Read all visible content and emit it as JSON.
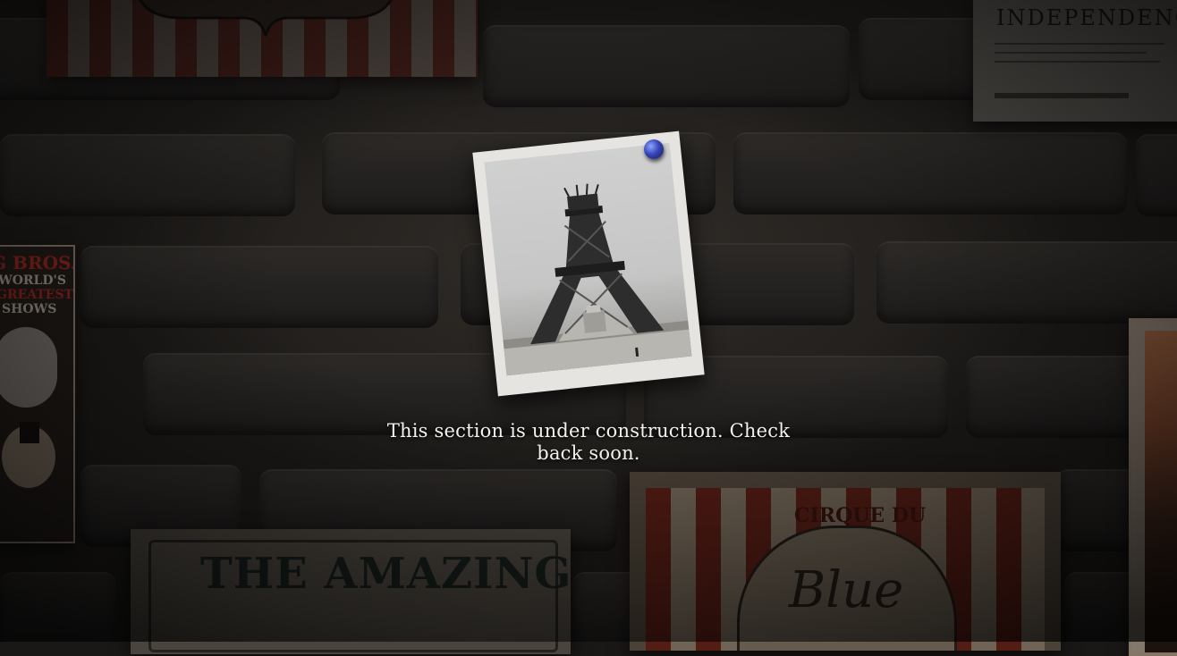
{
  "message": "This section is under construction. Check back soon.",
  "posters": {
    "top_right_title": "INDEPENDENC",
    "left_title_1": "G BROS.",
    "left_title_2": "WORLD'S",
    "left_title_3": "GREATEST",
    "left_title_4": "SHOWS",
    "bottom_left_title": "THE AMAZING",
    "bottom_right_title_1": "CIRQUE DU",
    "bottom_right_title_2": "Blue"
  },
  "colors": {
    "wall": "#1c1a18",
    "pin": "#3646b8",
    "text": "#f3f1ec"
  }
}
